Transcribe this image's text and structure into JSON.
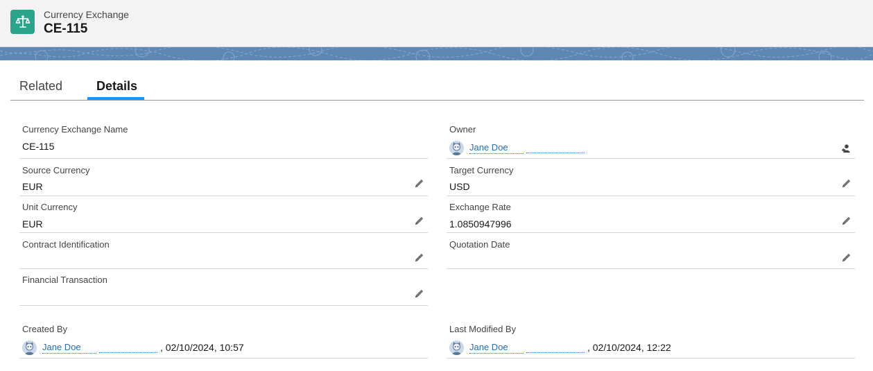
{
  "header": {
    "object_label": "Currency Exchange",
    "record_name": "CE-115",
    "icon": "scales-icon"
  },
  "tabs": [
    {
      "label": "Related",
      "active": false
    },
    {
      "label": "Details",
      "active": true
    }
  ],
  "fields": {
    "name": {
      "label": "Currency Exchange Name",
      "value": "CE-115"
    },
    "owner": {
      "label": "Owner",
      "user": "Jane Doe"
    },
    "source_currency": {
      "label": "Source Currency",
      "value": "EUR"
    },
    "target_currency": {
      "label": "Target Currency",
      "value": "USD"
    },
    "unit_currency": {
      "label": "Unit Currency",
      "value": "EUR"
    },
    "exchange_rate": {
      "label": "Exchange Rate",
      "value": "1.0850947996"
    },
    "contract_identification": {
      "label": "Contract Identification",
      "value": ""
    },
    "quotation_date": {
      "label": "Quotation Date",
      "value": ""
    },
    "financial_transaction": {
      "label": "Financial Transaction",
      "value": ""
    },
    "created_by": {
      "label": "Created By",
      "user": "Jane Doe",
      "date": ", 02/10/2024, 10:57"
    },
    "last_modified_by": {
      "label": "Last Modified By",
      "user": "Jane Doe",
      "date": ", 02/10/2024, 12:22"
    }
  },
  "colors": {
    "accent": "#1b96ff",
    "icon_bg": "#2aa58b",
    "link": "#2a6db3",
    "banner": "#5f87b4"
  }
}
